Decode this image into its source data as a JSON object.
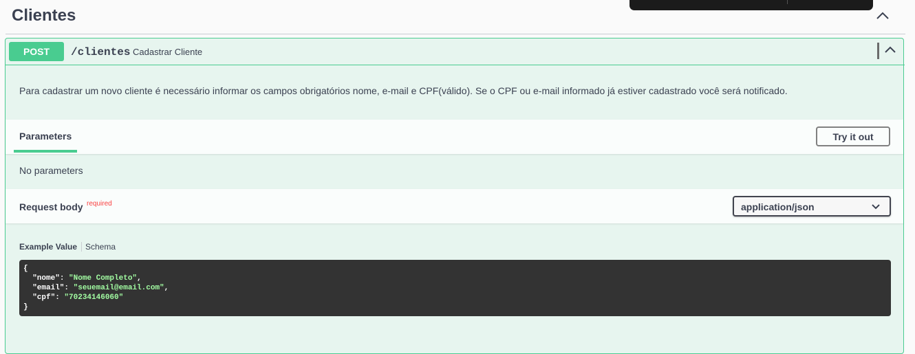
{
  "tag": {
    "title": "Clientes"
  },
  "operation": {
    "method": "POST",
    "path": "/clientes",
    "summary": "Cadastrar Cliente",
    "description": "Para cadastrar um novo cliente é necessário informar os campos obrigatórios nome, e-mail e CPF(válido). Se o CPF ou e-mail informado já estiver cadastrado você será notificado."
  },
  "parameters": {
    "tab_label": "Parameters",
    "try_button": "Try it out",
    "empty_text": "No parameters"
  },
  "request_body": {
    "title": "Request body",
    "required_label": "required",
    "content_type": "application/json",
    "tabs": {
      "example": "Example Value",
      "schema": "Schema"
    },
    "example": {
      "open": "{",
      "close": "}",
      "fields": [
        {
          "key": "\"nome\"",
          "value": "\"Nome Completo\"",
          "trail": ","
        },
        {
          "key": "\"email\"",
          "value": "\"seuemail@email.com\"",
          "trail": ","
        },
        {
          "key": "\"cpf\"",
          "value": "\"70234146060\"",
          "trail": ""
        }
      ]
    }
  },
  "colors": {
    "post": "#49cc90",
    "string": "#a2fca2",
    "code_bg": "#333333",
    "required": "#f93e3e"
  }
}
